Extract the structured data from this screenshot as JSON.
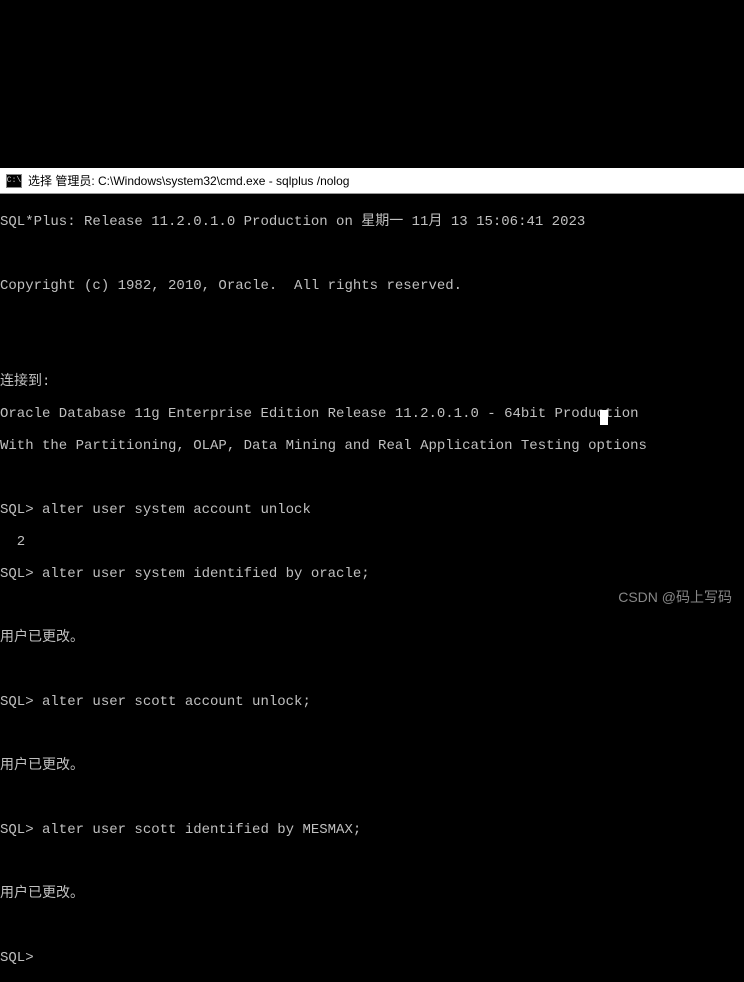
{
  "titlebar": {
    "icon_text": "C:\\",
    "title": "选择 管理员: C:\\Windows\\system32\\cmd.exe - sqlplus /nolog"
  },
  "terminal": {
    "lines": [
      "SQL*Plus: Release 11.2.0.1.0 Production on 星期一 11月 13 15:06:41 2023",
      "",
      "Copyright (c) 1982, 2010, Oracle.  All rights reserved.",
      "",
      "",
      "连接到:",
      "Oracle Database 11g Enterprise Edition Release 11.2.0.1.0 - 64bit Production",
      "With the Partitioning, OLAP, Data Mining and Real Application Testing options",
      "",
      "SQL> alter user system account unlock",
      "  2",
      "SQL> alter user system identified by oracle;",
      "",
      "用户已更改。",
      "",
      "SQL> alter user scott account unlock;",
      "",
      "用户已更改。",
      "",
      "SQL> alter user scott identified by MESMAX;",
      "",
      "用户已更改。",
      "",
      "SQL>"
    ]
  },
  "watermark": "CSDN @码上写码"
}
